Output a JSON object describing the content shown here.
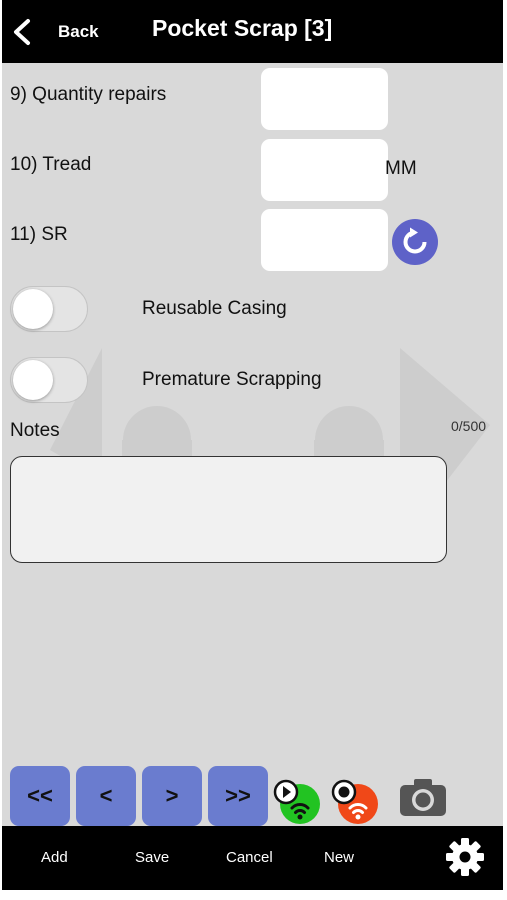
{
  "header": {
    "back_label": "Back",
    "title": "Pocket Scrap [3]"
  },
  "form": {
    "fields": [
      {
        "label": "9) Quantity repairs",
        "value": ""
      },
      {
        "label": "10) Tread",
        "value": "",
        "unit": "MM"
      },
      {
        "label": "11) SR",
        "value": ""
      }
    ],
    "toggles": [
      {
        "label": "Reusable Casing",
        "on": false
      },
      {
        "label": "Premature Scrapping",
        "on": false
      }
    ],
    "notes": {
      "label": "Notes",
      "counter": "0/500",
      "value": ""
    }
  },
  "nav": {
    "first": "<<",
    "prev": "<",
    "next": ">",
    "last": ">>"
  },
  "icons": {
    "back": "chevron-left-icon",
    "refresh": "refresh-icon",
    "online_status": "play-wifi-icon",
    "record_status": "record-wifi-icon",
    "camera": "camera-icon",
    "settings": "gear-icon"
  },
  "colors": {
    "nav_button": "#6a7ccf",
    "refresh": "#5e62c8",
    "online": "#22c322",
    "record": "#f04818"
  },
  "footer": {
    "add": "Add",
    "save": "Save",
    "cancel": "Cancel",
    "new": "New"
  }
}
